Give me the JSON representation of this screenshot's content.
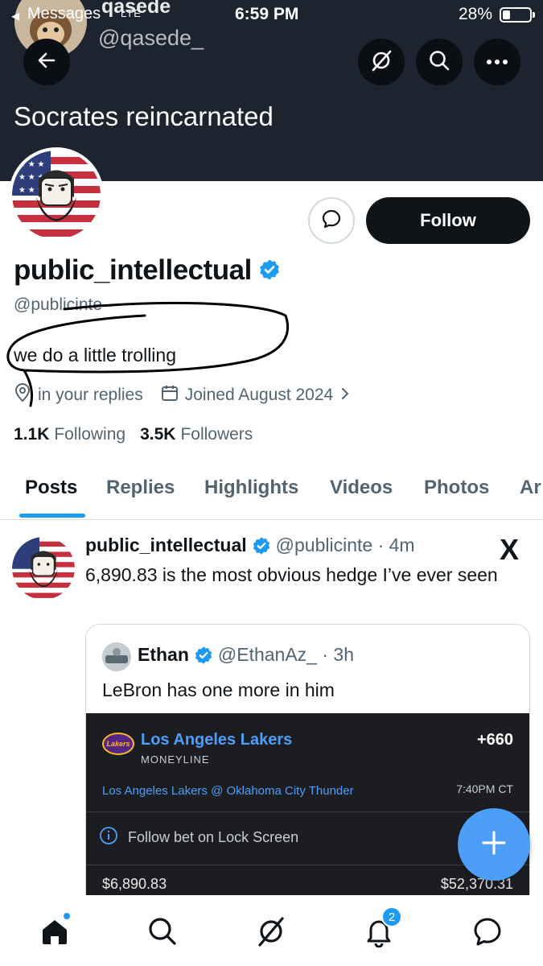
{
  "status_bar": {
    "back_label": "◂",
    "messages_label": "Messages",
    "network": "LTE",
    "time": "6:59 PM",
    "battery_text": "28%",
    "battery_level": 0.28
  },
  "peek": {
    "name": "qasede",
    "handle": "@qasede_"
  },
  "banner": {
    "bio_title": "Socrates reincarnated"
  },
  "header_buttons": {
    "back_icon": "arrow-left-icon",
    "grok_icon": "grok-icon",
    "search_icon": "search-icon",
    "more_icon": "more-icon"
  },
  "profile": {
    "follow_label": "Follow",
    "display_name": "public_intellectual",
    "handle": "@publicinte",
    "bio": "we do a little trolling",
    "location": "in your replies",
    "joined": "Joined August 2024",
    "following_count": "1.1K",
    "following_label": "Following",
    "followers_count": "3.5K",
    "followers_label": "Followers"
  },
  "tabs": [
    {
      "label": "Posts",
      "active": true
    },
    {
      "label": "Replies",
      "active": false
    },
    {
      "label": "Highlights",
      "active": false
    },
    {
      "label": "Videos",
      "active": false
    },
    {
      "label": "Photos",
      "active": false
    },
    {
      "label": "Ar",
      "active": false
    }
  ],
  "post": {
    "name": "public_intellectual",
    "meta": "@publicinte · 4m",
    "text": "6,890.83 is the most obvious hedge I’ve ever seen",
    "x_logo": "X",
    "quote": {
      "name": "Ethan",
      "meta": "@EthanAz_ · 3h",
      "text": "LeBron has one more in him",
      "bet": {
        "logo_text": "Lakers",
        "team": "Los Angeles Lakers",
        "type": "MONEYLINE",
        "odds": "+660",
        "game": "Los Angeles Lakers @ Oklahoma City Thunder",
        "time": "7:40PM CT",
        "follow_text": "Follow bet on Lock Screen",
        "stake": "$6,890.83",
        "payout": "$52,370.31"
      }
    }
  },
  "bottom_nav": {
    "notifications_badge": "2"
  },
  "colors": {
    "accent": "#1d9bf0",
    "banner": "#1d2430",
    "bet_blue": "#4c9ef8"
  }
}
